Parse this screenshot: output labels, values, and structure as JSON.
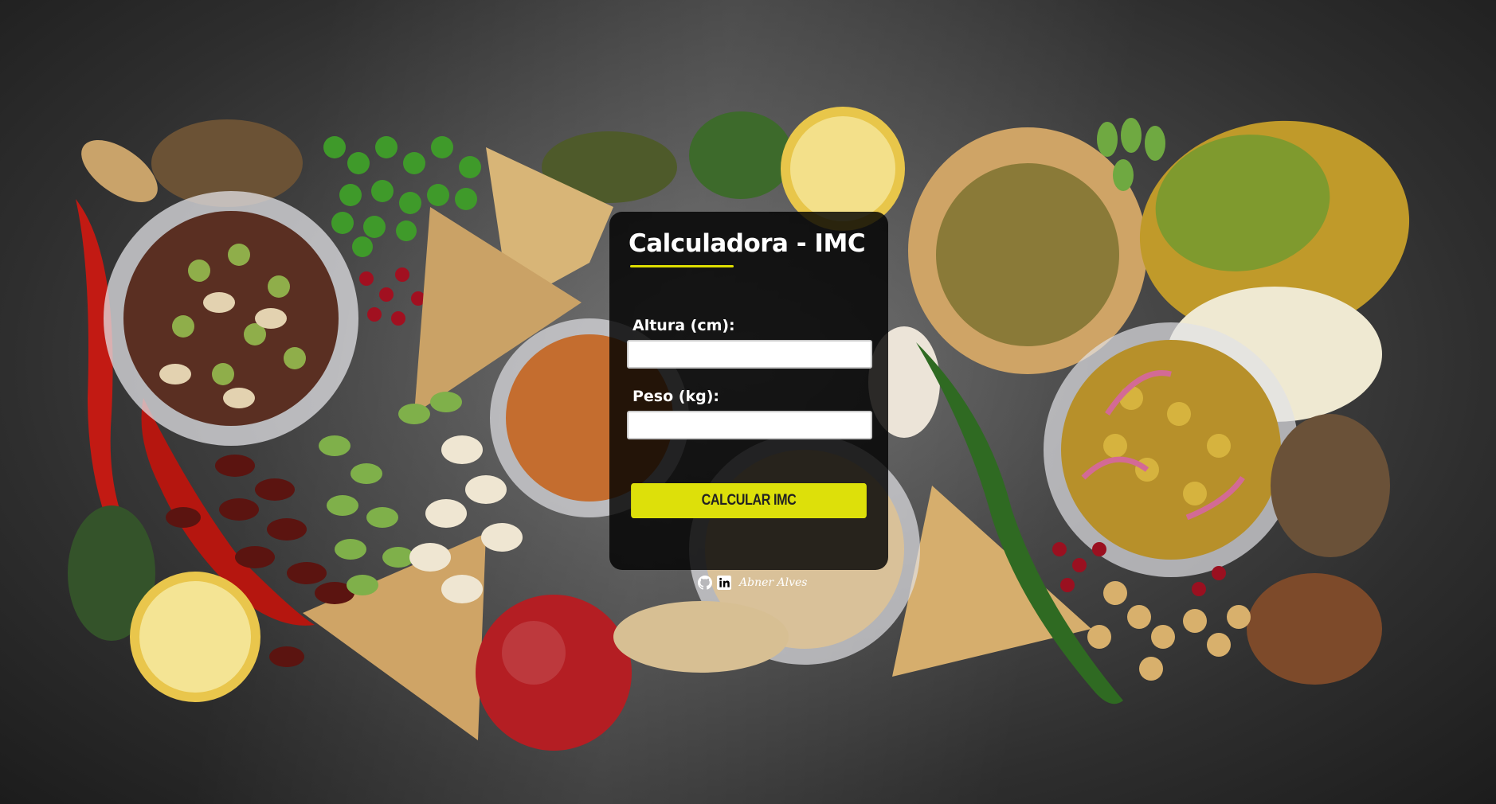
{
  "app": {
    "title": "Calculadora - IMC"
  },
  "form": {
    "height_label": "Altura (cm):",
    "height_value": "",
    "weight_label": "Peso (kg):",
    "weight_value": "",
    "submit_label": "CALCULAR IMC"
  },
  "footer": {
    "icons": [
      "github-icon",
      "linkedin-icon"
    ],
    "author": "Abner Alves"
  },
  "colors": {
    "accent": "#dde00a",
    "card_background": "#000000",
    "text": "#ffffff"
  }
}
